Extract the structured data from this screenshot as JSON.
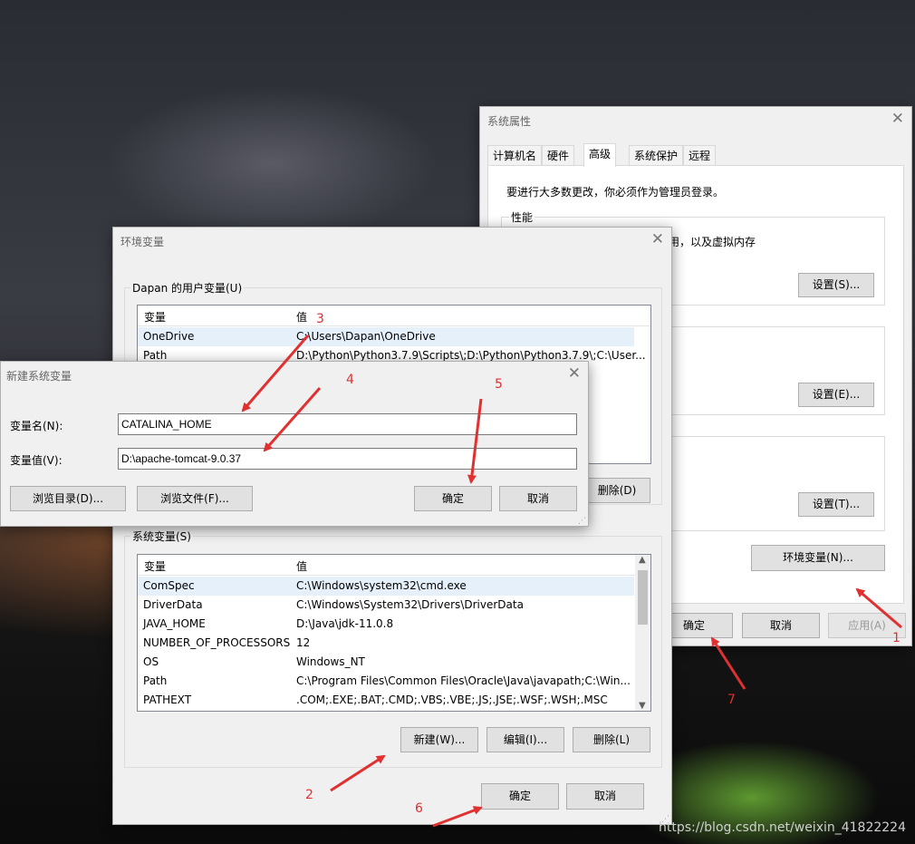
{
  "sysprops": {
    "title": "系统属性",
    "tabs": [
      "计算机名",
      "硬件",
      "高级",
      "系统保护",
      "远程"
    ],
    "admin_notice": "要进行大多数更改，你必须作为管理员登录。",
    "perf_label": "性能",
    "perf_desc_tail": "用，以及虚拟内存",
    "settings1": "设置(S)...",
    "settings2": "设置(E)...",
    "settings3": "设置(T)...",
    "envvars_btn": "环境变量(N)...",
    "ok": "确定",
    "cancel": "取消",
    "apply": "应用(A)"
  },
  "envvars": {
    "title": "环境变量",
    "user_group": "Dapan 的用户变量(U)",
    "col_var": "变量",
    "col_val": "值",
    "user_rows": [
      {
        "name": "OneDrive",
        "value": "C:\\Users\\Dapan\\OneDrive"
      },
      {
        "name": "Path",
        "value": "D:\\Python\\Python3.7.9\\Scripts\\;D:\\Python\\Python3.7.9\\;C:\\User..."
      }
    ],
    "user_delete": "删除(D)",
    "sys_group": "系统变量(S)",
    "sys_rows": [
      {
        "name": "ComSpec",
        "value": "C:\\Windows\\system32\\cmd.exe"
      },
      {
        "name": "DriverData",
        "value": "C:\\Windows\\System32\\Drivers\\DriverData"
      },
      {
        "name": "JAVA_HOME",
        "value": "D:\\Java\\jdk-11.0.8"
      },
      {
        "name": "NUMBER_OF_PROCESSORS",
        "value": "12"
      },
      {
        "name": "OS",
        "value": "Windows_NT"
      },
      {
        "name": "Path",
        "value": "C:\\Program Files\\Common Files\\Oracle\\Java\\javapath;C:\\Win..."
      },
      {
        "name": "PATHEXT",
        "value": ".COM;.EXE;.BAT;.CMD;.VBS;.VBE;.JS;.JSE;.WSF;.WSH;.MSC"
      }
    ],
    "new_btn": "新建(W)...",
    "edit_btn": "编辑(I)...",
    "delete_btn": "删除(L)",
    "ok": "确定",
    "cancel": "取消"
  },
  "newvar": {
    "title": "新建系统变量",
    "name_label": "变量名(N):",
    "name_value": "CATALINA_HOME",
    "value_label": "变量值(V):",
    "value_value": "D:\\apache-tomcat-9.0.37",
    "browse_dir": "浏览目录(D)...",
    "browse_file": "浏览文件(F)...",
    "ok": "确定",
    "cancel": "取消"
  },
  "annotations": [
    "1",
    "2",
    "3",
    "4",
    "5",
    "6",
    "7"
  ],
  "watermark": "https://blog.csdn.net/weixin_41822224",
  "colors": {
    "annotation": "#e03030",
    "selection": "#e6f0fa"
  }
}
